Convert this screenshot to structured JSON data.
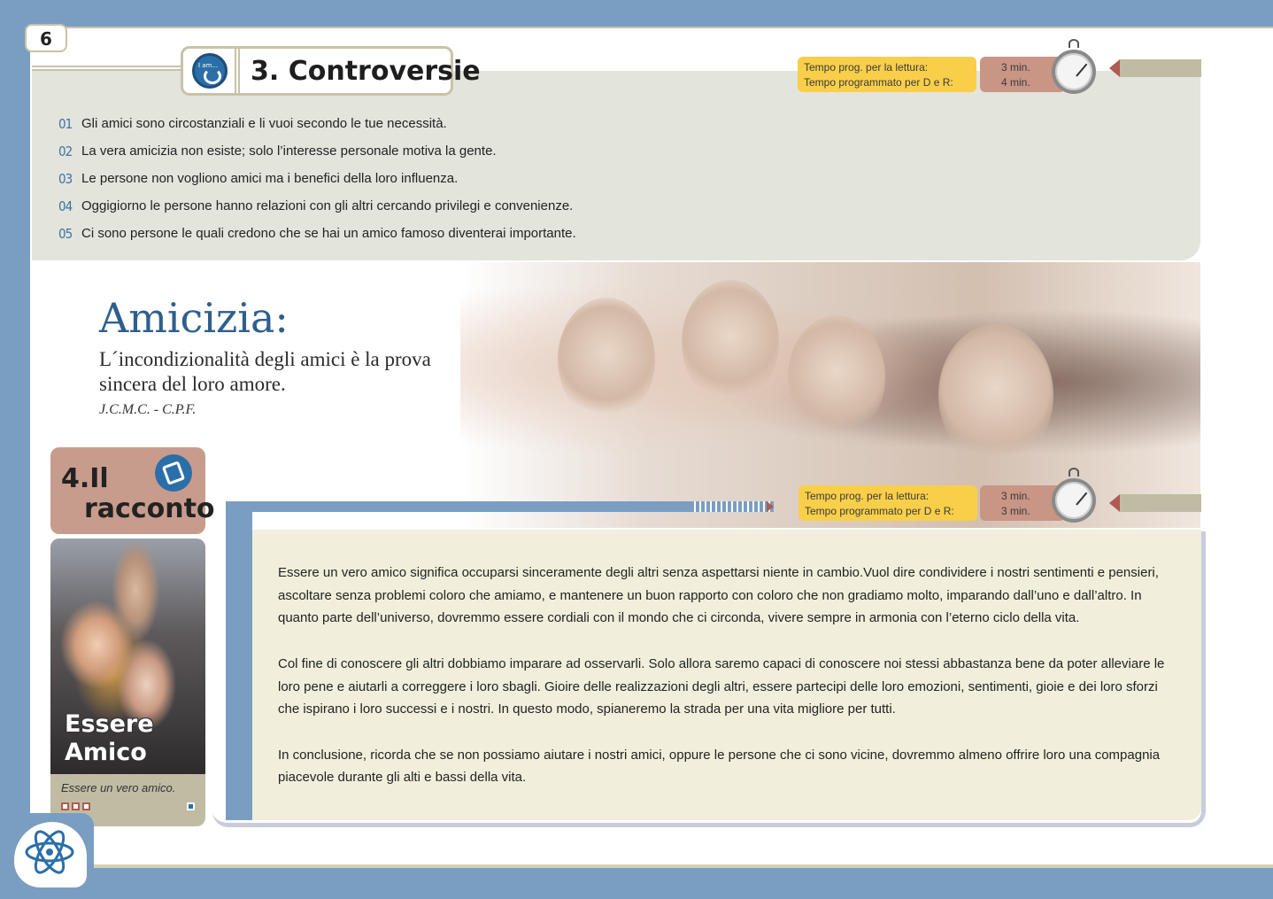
{
  "page": {
    "number": "6"
  },
  "controversie": {
    "icon_tag": "I am...",
    "title": "3. Controversie",
    "timer": {
      "reading_label": "Tempo prog. per la lettura:",
      "qa_label": "Tempo programmato per D e R:",
      "reading_value": "3 min.",
      "qa_value": "4 min."
    },
    "items": [
      {
        "num": "01",
        "text": "Gli amici sono circostanziali e li vuoi secondo le tue necessità."
      },
      {
        "num": "02",
        "text": "La vera amicizia non esiste; solo l’interesse personale motiva la gente."
      },
      {
        "num": "03",
        "text": "Le persone non vogliono amici ma i benefici della loro influenza."
      },
      {
        "num": "04",
        "text": "Oggigiorno le persone hanno relazioni con gli altri cercando privilegi e convenienze."
      },
      {
        "num": "05",
        "text": "Ci sono persone le quali credono che se hai un amico famoso diventerai importante."
      }
    ]
  },
  "amicizia": {
    "title": "Amicizia:",
    "quote": "L´incondizionalità degli amici è la prova sincera del loro amore.",
    "author": "J.C.M.C. - C.P.F."
  },
  "racconto": {
    "number": "4.Il",
    "label": "racconto",
    "timer": {
      "reading_label": "Tempo prog. per la lettura:",
      "qa_label": "Tempo programmato per D e R:",
      "reading_value": "3 min.",
      "qa_value": "3 min."
    },
    "card": {
      "title_line1": "Essere",
      "title_line2": "Amico",
      "caption": "Essere un vero amico."
    },
    "paragraphs": [
      "Essere un vero amico significa occuparsi sinceramente degli altri senza aspettarsi niente in cambio.Vuol dire condividere i nostri sentimenti e pensieri, ascoltare senza problemi coloro che amiamo, e mantenere un buon rapporto con coloro che non gradiamo molto, imparando dall’uno e dall’altro. In quanto parte dell’universo, dovremmo essere cordiali con il mondo che ci circonda, vivere sempre in armonia con l’eterno ciclo della vita.",
      "Col fine di conoscere gli altri dobbiamo imparare ad osservarli. Solo allora saremo capaci di conoscere noi stessi abbastanza bene da poter alleviare le loro pene e aiutarli a correggere i loro sbagli. Gioire delle realizzazioni degli altri, essere partecipi delle loro emozioni, sentimenti, gioie e dei loro sforzi che ispirano i loro successi e i nostri. In questo modo, spianeremo la strada per una vita migliore per tutti.",
      "In conclusione, ricorda che se non possiamo aiutare i nostri amici, oppure le persone che ci sono vicine, dovremmo almeno offrire loro una compagnia piacevole durante gli alti e bassi della vita."
    ]
  },
  "colors": {
    "accent_blue": "#2e5f8c",
    "timer_yellow": "#f9cf4a",
    "timer_brown": "#c99585",
    "frame_blue": "#7a9ec2"
  },
  "icons": [
    "i-am-icon",
    "stopwatch-icon",
    "book-icon",
    "brain-atom-icon"
  ]
}
